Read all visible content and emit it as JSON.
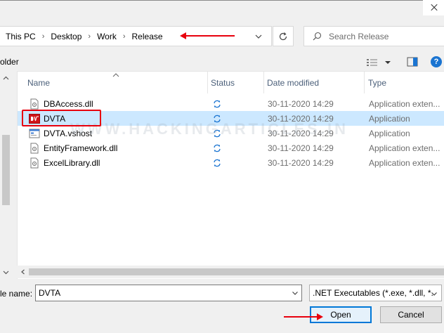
{
  "breadcrumb": [
    "This PC",
    "Desktop",
    "Work",
    "Release"
  ],
  "search": {
    "placeholder": "Search Release"
  },
  "toolbar": {
    "left_label": "older"
  },
  "columns": [
    {
      "label": "Name",
      "left": 0
    },
    {
      "label": "Status"
    },
    {
      "label": "Date modified"
    },
    {
      "label": "Type"
    }
  ],
  "files": [
    {
      "name": "DBAccess.dll",
      "icon": "dll-file-icon",
      "status": "sync-icon",
      "date": "30-11-2020 14:29",
      "type": "Application exten...",
      "selected": false
    },
    {
      "name": "DVTA",
      "icon": "dvta-app-icon",
      "status": "sync-icon",
      "date": "30-11-2020 14:29",
      "type": "Application",
      "selected": true
    },
    {
      "name": "DVTA.vshost",
      "icon": "exe-file-icon",
      "status": "sync-icon",
      "date": "30-11-2020 14:29",
      "type": "Application",
      "selected": false
    },
    {
      "name": "EntityFramework.dll",
      "icon": "dll-file-icon",
      "status": "sync-icon",
      "date": "30-11-2020 14:29",
      "type": "Application exten...",
      "selected": false
    },
    {
      "name": "ExcelLibrary.dll",
      "icon": "dll-file-icon",
      "status": "sync-icon",
      "date": "30-11-2020 14:29",
      "type": "Application exten...",
      "selected": false
    }
  ],
  "filename": {
    "label": "le name:",
    "value": "DVTA"
  },
  "filetype": {
    "value": ".NET Executables (*.exe, *.dll, *."
  },
  "buttons": {
    "open": "Open",
    "cancel": "Cancel"
  },
  "help_label": "?",
  "watermark": "WWW.HACKINGARTICLES.IN",
  "colors": {
    "selection": "#cce8ff",
    "annotation": "#e8000d",
    "accent": "#0078d7"
  }
}
